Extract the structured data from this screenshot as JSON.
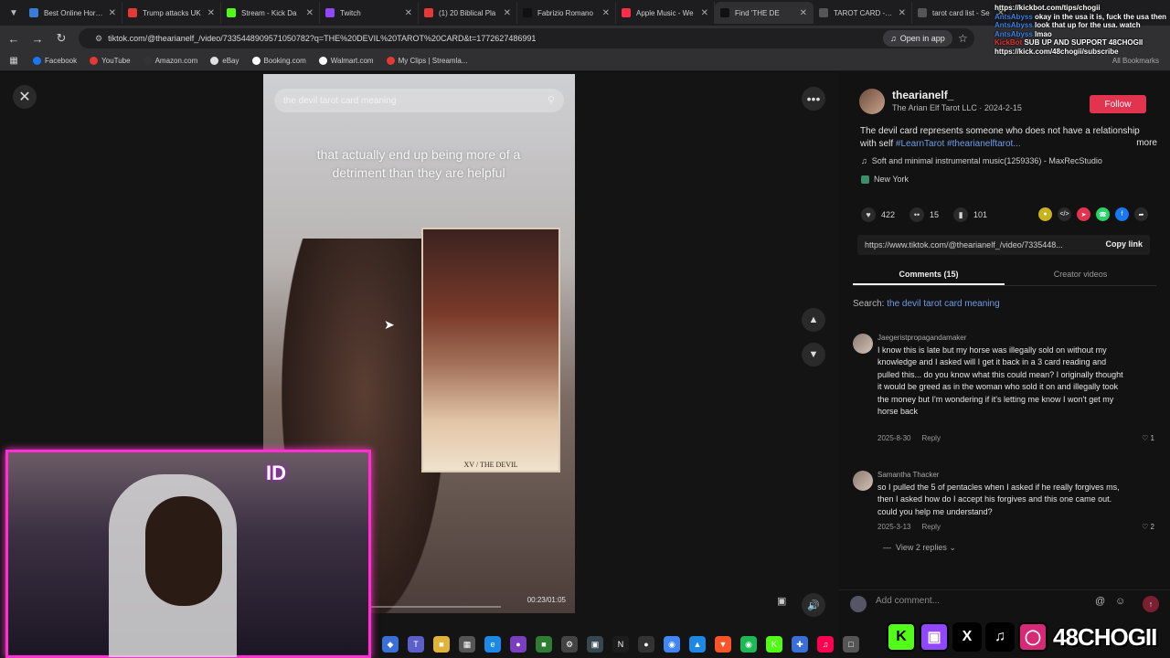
{
  "tabs": [
    {
      "label": "Best Online Horse",
      "color": "#3a7bd5"
    },
    {
      "label": "Trump attacks UK",
      "color": "#e53935"
    },
    {
      "label": "Stream - Kick Da",
      "color": "#53fc18"
    },
    {
      "label": "Twitch",
      "color": "#9146ff"
    },
    {
      "label": "(1) 20 Biblical Pla",
      "color": "#e53935"
    },
    {
      "label": "Fabrizio Romano",
      "color": "#111111"
    },
    {
      "label": "Apple Music - We",
      "color": "#fa2d48"
    },
    {
      "label": "Find 'THE DE",
      "color": "#111111"
    },
    {
      "label": "TAROT CARD - Se",
      "color": "#555555"
    },
    {
      "label": "tarot card list - Se",
      "color": "#555555"
    }
  ],
  "address": {
    "url": "tiktok.com/@thearianelf_/video/7335448909571050782?q=THE%20DEVIL%20TAROT%20CARD&t=1772627486991",
    "open_app": "Open in app"
  },
  "bookmarks": [
    {
      "label": "Facebook",
      "color": "#1877f2"
    },
    {
      "label": "YouTube",
      "color": "#e53935"
    },
    {
      "label": "Amazon.com",
      "color": "#333333"
    },
    {
      "label": "eBay",
      "color": "#e0e0e0"
    },
    {
      "label": "Booking.com",
      "color": "#ffffff"
    },
    {
      "label": "Walmart.com",
      "color": "#ffffff"
    },
    {
      "label": "My Clips | Streamla...",
      "color": "#e53935"
    }
  ],
  "all_bookmarks": "All Bookmarks",
  "video": {
    "search_text": "the devil tarot card meaning",
    "caption": "that actually end up being more of a detriment than they are helpful",
    "card_label": "XV / THE DEVIL",
    "timecode": "00:23/01:05",
    "progress": 0.02
  },
  "post": {
    "username": "thearianelf_",
    "subline": "The Arian Elf Tarot LLC · 2024-2-15",
    "follow": "Follow",
    "description": "The devil card represents someone who does not have a relationship with self ",
    "tags": "#LearnTarot #thearianelftarot...",
    "more": "more",
    "music": "Soft and minimal instrumental music(1259336) - MaxRecStudio",
    "location": "New York",
    "likes": "422",
    "comments_count": "15",
    "saves": "101",
    "link": "https://www.tiktok.com/@thearianelf_/video/7335448...",
    "copy_link": "Copy link"
  },
  "panel_tabs": {
    "comments": "Comments (15)",
    "creator_videos": "Creator videos"
  },
  "search": {
    "prefix": "Search: ",
    "query": "the devil tarot card meaning"
  },
  "comments": [
    {
      "user": "Jaegeristpropagandamaker",
      "text": "I know this is late but my horse was illegally sold on without my knowledge and I asked will I get it back in a 3 card reading and pulled this... do you know what this could mean? I originally thought it would be greed as in the woman who sold it on and illegally took the money but I'm wondering if it's letting me know I won't get my horse back",
      "date": "2025-8-30",
      "reply": "Reply",
      "likes": "1"
    },
    {
      "user": "Samantha Thacker",
      "text": "so I pulled the 5 of pentacles when I asked if he really forgives ms, then I asked how do I accept his forgives and this one came out. could you help me understand?",
      "date": "2025-3-13",
      "reply": "Reply",
      "likes": "2"
    }
  ],
  "view_replies": "View 2 replies",
  "add_comment": "Add comment...",
  "chat": [
    {
      "user": "",
      "msg": "https://kickbot.com/tips/chogii",
      "red": false
    },
    {
      "user": "AntsAbyss",
      "msg": "okay in the usa it is, fuck the usa then",
      "red": false
    },
    {
      "user": "AntsAbyss",
      "msg": "look that up for the usa. watch",
      "red": false
    },
    {
      "user": "AntsAbyss",
      "msg": "lmao",
      "red": false
    },
    {
      "user": "KickBot",
      "msg": "SUB UP AND SUPPORT 48CHOGII https://kick.com/48chogii/subscribe",
      "red": true
    }
  ],
  "webcam_logo": "ID",
  "channel_handle": "48CHOGII",
  "icons": {
    "close": "close-icon",
    "more": "more-dots-icon",
    "up": "chevron-up-icon",
    "down": "chevron-down-icon"
  }
}
